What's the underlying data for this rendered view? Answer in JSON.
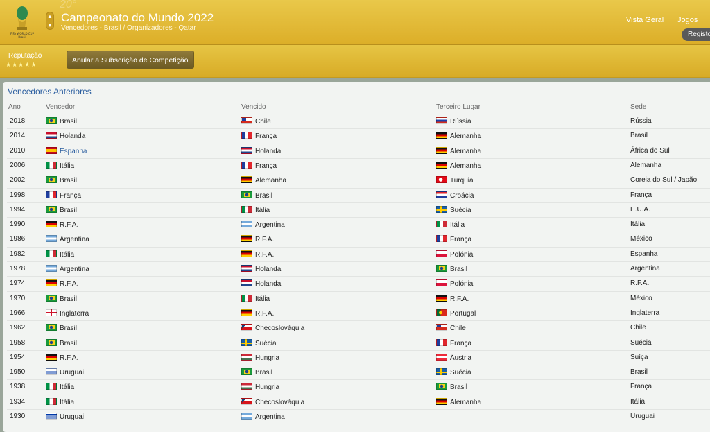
{
  "header": {
    "title": "Campeonato do Mundo 2022",
    "subtitle": "Vencedores - Brasil / Organizadores - Qatar",
    "year_watermark": "20°",
    "logo_text": "FIFA WORLD CUP Brasil",
    "nav": {
      "overview": "Vista Geral",
      "games": "Jogos",
      "registo": "Registo"
    }
  },
  "subbar": {
    "reputation_label": "Reputação",
    "reputation_stars": 5,
    "unsubscribe_label": "Anular a Subscrição de Competição"
  },
  "table": {
    "title": "Vencedores Anteriores",
    "columns": [
      "Ano",
      "Vencedor",
      "Vencido",
      "Terceiro Lugar",
      "Sede"
    ],
    "rows": [
      {
        "ano": "2018",
        "w": "Brasil",
        "wf": "BR",
        "r": "Chile",
        "rf": "CL",
        "t": "Rússia",
        "tf": "RU",
        "sede": "Rússia"
      },
      {
        "ano": "2014",
        "w": "Holanda",
        "wf": "NL",
        "r": "França",
        "rf": "FR",
        "t": "Alemanha",
        "tf": "DE",
        "sede": "Brasil"
      },
      {
        "ano": "2010",
        "w": "Espanha",
        "wf": "ES",
        "w_link": true,
        "r": "Holanda",
        "rf": "NL",
        "t": "Alemanha",
        "tf": "DE",
        "sede": "África do Sul"
      },
      {
        "ano": "2006",
        "w": "Itália",
        "wf": "IT",
        "r": "França",
        "rf": "FR",
        "t": "Alemanha",
        "tf": "DE",
        "sede": "Alemanha"
      },
      {
        "ano": "2002",
        "w": "Brasil",
        "wf": "BR",
        "r": "Alemanha",
        "rf": "DE",
        "t": "Turquia",
        "tf": "TR",
        "sede": "Coreia do Sul / Japão"
      },
      {
        "ano": "1998",
        "w": "França",
        "wf": "FR",
        "r": "Brasil",
        "rf": "BR",
        "t": "Croácia",
        "tf": "HR",
        "sede": "França"
      },
      {
        "ano": "1994",
        "w": "Brasil",
        "wf": "BR",
        "r": "Itália",
        "rf": "IT",
        "t": "Suécia",
        "tf": "SE",
        "sede": "E.U.A."
      },
      {
        "ano": "1990",
        "w": "R.F.A.",
        "wf": "DE",
        "r": "Argentina",
        "rf": "AR",
        "t": "Itália",
        "tf": "IT",
        "sede": "Itália"
      },
      {
        "ano": "1986",
        "w": "Argentina",
        "wf": "AR",
        "r": "R.F.A.",
        "rf": "DE",
        "t": "França",
        "tf": "FR",
        "sede": "México"
      },
      {
        "ano": "1982",
        "w": "Itália",
        "wf": "IT",
        "r": "R.F.A.",
        "rf": "DE",
        "t": "Polónia",
        "tf": "PL",
        "sede": "Espanha"
      },
      {
        "ano": "1978",
        "w": "Argentina",
        "wf": "AR",
        "r": "Holanda",
        "rf": "NL",
        "t": "Brasil",
        "tf": "BR",
        "sede": "Argentina"
      },
      {
        "ano": "1974",
        "w": "R.F.A.",
        "wf": "DE",
        "r": "Holanda",
        "rf": "NL",
        "t": "Polónia",
        "tf": "PL",
        "sede": "R.F.A."
      },
      {
        "ano": "1970",
        "w": "Brasil",
        "wf": "BR",
        "r": "Itália",
        "rf": "IT",
        "t": "R.F.A.",
        "tf": "DE",
        "sede": "México"
      },
      {
        "ano": "1966",
        "w": "Inglaterra",
        "wf": "EN",
        "r": "R.F.A.",
        "rf": "DE",
        "t": "Portugal",
        "tf": "PT",
        "sede": "Inglaterra"
      },
      {
        "ano": "1962",
        "w": "Brasil",
        "wf": "BR",
        "r": "Checoslováquia",
        "rf": "CZ",
        "t": "Chile",
        "tf": "CL",
        "sede": "Chile"
      },
      {
        "ano": "1958",
        "w": "Brasil",
        "wf": "BR",
        "r": "Suécia",
        "rf": "SE",
        "t": "França",
        "tf": "FR",
        "sede": "Suécia"
      },
      {
        "ano": "1954",
        "w": "R.F.A.",
        "wf": "DE",
        "r": "Hungria",
        "rf": "HU",
        "t": "Áustria",
        "tf": "AT",
        "sede": "Suíça"
      },
      {
        "ano": "1950",
        "w": "Uruguai",
        "wf": "UY",
        "r": "Brasil",
        "rf": "BR",
        "t": "Suécia",
        "tf": "SE",
        "sede": "Brasil"
      },
      {
        "ano": "1938",
        "w": "Itália",
        "wf": "IT",
        "r": "Hungria",
        "rf": "HU",
        "t": "Brasil",
        "tf": "BR",
        "sede": "França"
      },
      {
        "ano": "1934",
        "w": "Itália",
        "wf": "IT",
        "r": "Checoslováquia",
        "rf": "CZ",
        "t": "Alemanha",
        "tf": "DE",
        "sede": "Itália"
      },
      {
        "ano": "1930",
        "w": "Uruguai",
        "wf": "UY",
        "r": "Argentina",
        "rf": "AR",
        "t": "",
        "tf": "",
        "sede": "Uruguai"
      }
    ]
  },
  "flag_styles": {
    "BR": "radial-gradient(circle at 50% 50%, #1d3f8f 0 2px, transparent 2.5px), linear-gradient(#f6d31a,#f6d31a) center/9px 6px no-repeat, #1a9b3c",
    "CL": "linear-gradient(90deg,#1f3e9e 0 6px, transparent 6px) top/100% 50% no-repeat, linear-gradient(#ffffff 0 50%, #d52b1e 50%)",
    "RU": "linear-gradient(#ffffff 0 33%, #1c3faa 33% 66%, #d52b1e 66%)",
    "NL": "linear-gradient(#c8102e 0 33%, #ffffff 33% 66%, #21468b 66%)",
    "FR": "linear-gradient(90deg,#1f3e9e 0 33%, #ffffff 33% 66%, #e1262d 66%)",
    "DE": "linear-gradient(#111111 0 33%, #dd0000 33% 66%, #ffce00 66%)",
    "ES": "linear-gradient(#c60b1e 0 25%, #ffc400 25% 75%, #c60b1e 75%)",
    "IT": "linear-gradient(90deg,#009246 0 33%, #ffffff 33% 66%, #ce2b37 66%)",
    "TR": "radial-gradient(circle at 40% 50%, #ffffff 0 2.5px, transparent 3px), #e30a17",
    "HR": "linear-gradient(#e1262d 0 33%, #ffffff 33% 66%, #1f3e9e 66%)",
    "SE": "linear-gradient(90deg, transparent 0 5px, #fecc00 5px 7px, transparent 7px), linear-gradient(transparent 0 4px, #fecc00 4px 6px, transparent 6px), #1a5fa8",
    "AR": "linear-gradient(#75aadb 0 33%, #ffffff 33% 66%, #75aadb 66%)",
    "PL": "linear-gradient(#ffffff 0 50%, #dc143c 50%)",
    "EN": "linear-gradient(90deg, transparent 0 6px, #cf142b 6px 8px, transparent 8px), linear-gradient(transparent 0 3px, #cf142b 3px 5px, transparent 5px), #ffffff",
    "PT": "radial-gradient(circle at 38% 50%, #ffd400 0 2px, transparent 2.5px), linear-gradient(90deg,#046a38 0 40%, #da291c 40%)",
    "CZ": "linear-gradient(to bottom right, #11457e 0 35%, transparent 35%) left/8px 100% no-repeat, linear-gradient(#ffffff 0 50%, #d7141a 50%)",
    "HU": "linear-gradient(#ce2939 0 33%, #ffffff 33% 66%, #477050 66%)",
    "AT": "linear-gradient(#ed2939 0 33%, #ffffff 33% 66%, #ed2939 66%)",
    "UY": "repeating-linear-gradient(#ffffff 0 1.1px, #0038a8 1.1px 2.2px)"
  }
}
